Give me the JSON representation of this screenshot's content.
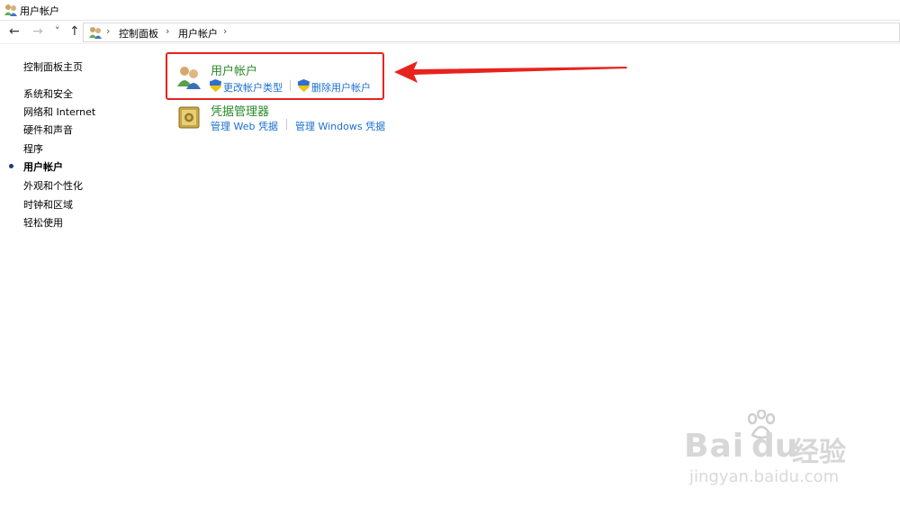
{
  "window": {
    "title": "用户帐户"
  },
  "nav": {
    "back": "←",
    "forward": "→",
    "recent": "˅",
    "up": "↑"
  },
  "breadcrumb": {
    "sep1": "›",
    "item1": "控制面板",
    "sep2": "›",
    "item2": "用户帐户",
    "sep3": "›"
  },
  "sidebar": {
    "home": "控制面板主页",
    "items": [
      {
        "label": "系统和安全"
      },
      {
        "label": "网络和 Internet"
      },
      {
        "label": "硬件和声音"
      },
      {
        "label": "程序"
      },
      {
        "label": "用户帐户",
        "active": true
      },
      {
        "label": "外观和个性化"
      },
      {
        "label": "时钟和区域"
      },
      {
        "label": "轻松使用"
      }
    ]
  },
  "categories": [
    {
      "title": "用户帐户",
      "icon": "users-icon",
      "links": [
        "更改帐户类型",
        "删除用户帐户"
      ],
      "highlighted": true
    },
    {
      "title": "凭据管理器",
      "icon": "vault-icon",
      "links": [
        "管理 Web 凭据",
        "管理 Windows 凭据"
      ]
    }
  ],
  "annotation": {
    "color": "#e8231d"
  },
  "watermark": {
    "brand": "Bai",
    "brand_end": "du",
    "cn": "经验",
    "url": "jingyan.baidu.com"
  },
  "colors": {
    "category_title": "#2a8b2a",
    "link": "#1a6fcf"
  }
}
